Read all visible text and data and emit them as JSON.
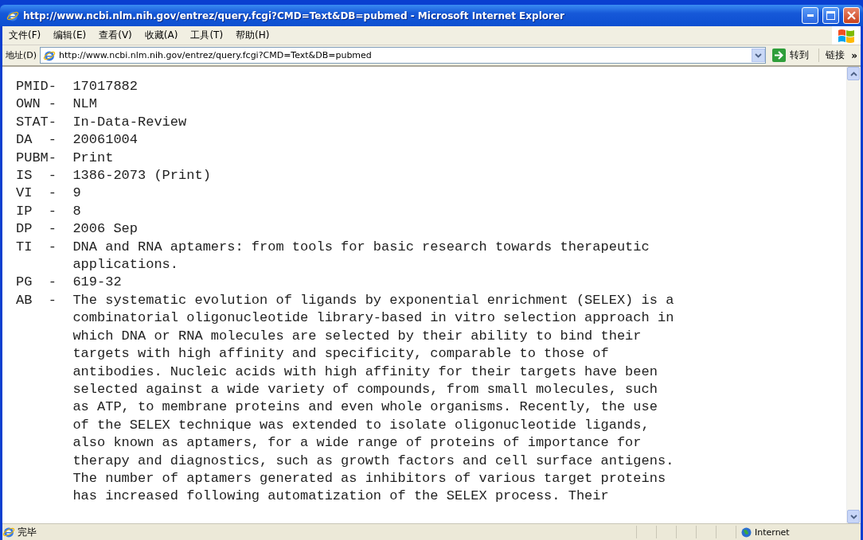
{
  "window": {
    "title": "http://www.ncbi.nlm.nih.gov/entrez/query.fcgi?CMD=Text&DB=pubmed - Microsoft Internet Explorer"
  },
  "menu": [
    "文件(F)",
    "编辑(E)",
    "查看(V)",
    "收藏(A)",
    "工具(T)",
    "帮助(H)"
  ],
  "address_bar": {
    "label": "地址(D)",
    "value": "http://www.ncbi.nlm.nih.gov/entrez/query.fcgi?CMD=Text&DB=pubmed",
    "go": "转到",
    "links": "链接",
    "more": "»"
  },
  "records": [
    {
      "tag": "PMID-",
      "lines": [
        "17017882"
      ]
    },
    {
      "tag": "OWN -",
      "lines": [
        "NLM"
      ]
    },
    {
      "tag": "STAT-",
      "lines": [
        "In-Data-Review"
      ]
    },
    {
      "tag": "DA  -",
      "lines": [
        "20061004"
      ]
    },
    {
      "tag": "PUBM-",
      "lines": [
        "Print"
      ]
    },
    {
      "tag": "IS  -",
      "lines": [
        "1386-2073 (Print)"
      ]
    },
    {
      "tag": "VI  -",
      "lines": [
        "9"
      ]
    },
    {
      "tag": "IP  -",
      "lines": [
        "8"
      ]
    },
    {
      "tag": "DP  -",
      "lines": [
        "2006 Sep"
      ]
    },
    {
      "tag": "TI  -",
      "lines": [
        "DNA and RNA aptamers: from tools for basic research towards therapeutic",
        "applications."
      ]
    },
    {
      "tag": "PG  -",
      "lines": [
        "619-32"
      ]
    },
    {
      "tag": "AB  -",
      "lines": [
        "The systematic evolution of ligands by exponential enrichment (SELEX) is a",
        "combinatorial oligonucleotide library-based in vitro selection approach in",
        "which DNA or RNA molecules are selected by their ability to bind their",
        "targets with high affinity and specificity, comparable to those of",
        "antibodies. Nucleic acids with high affinity for their targets have been",
        "selected against a wide variety of compounds, from small molecules, such",
        "as ATP, to membrane proteins and even whole organisms. Recently, the use",
        "of the SELEX technique was extended to isolate oligonucleotide ligands,",
        "also known as aptamers, for a wide range of proteins of importance for",
        "therapy and diagnostics, such as growth factors and cell surface antigens.",
        "The number of aptamers generated as inhibitors of various target proteins",
        "has increased following automatization of the SELEX process. Their"
      ]
    }
  ],
  "status_bar": {
    "text": "完毕",
    "zone": "Internet"
  }
}
